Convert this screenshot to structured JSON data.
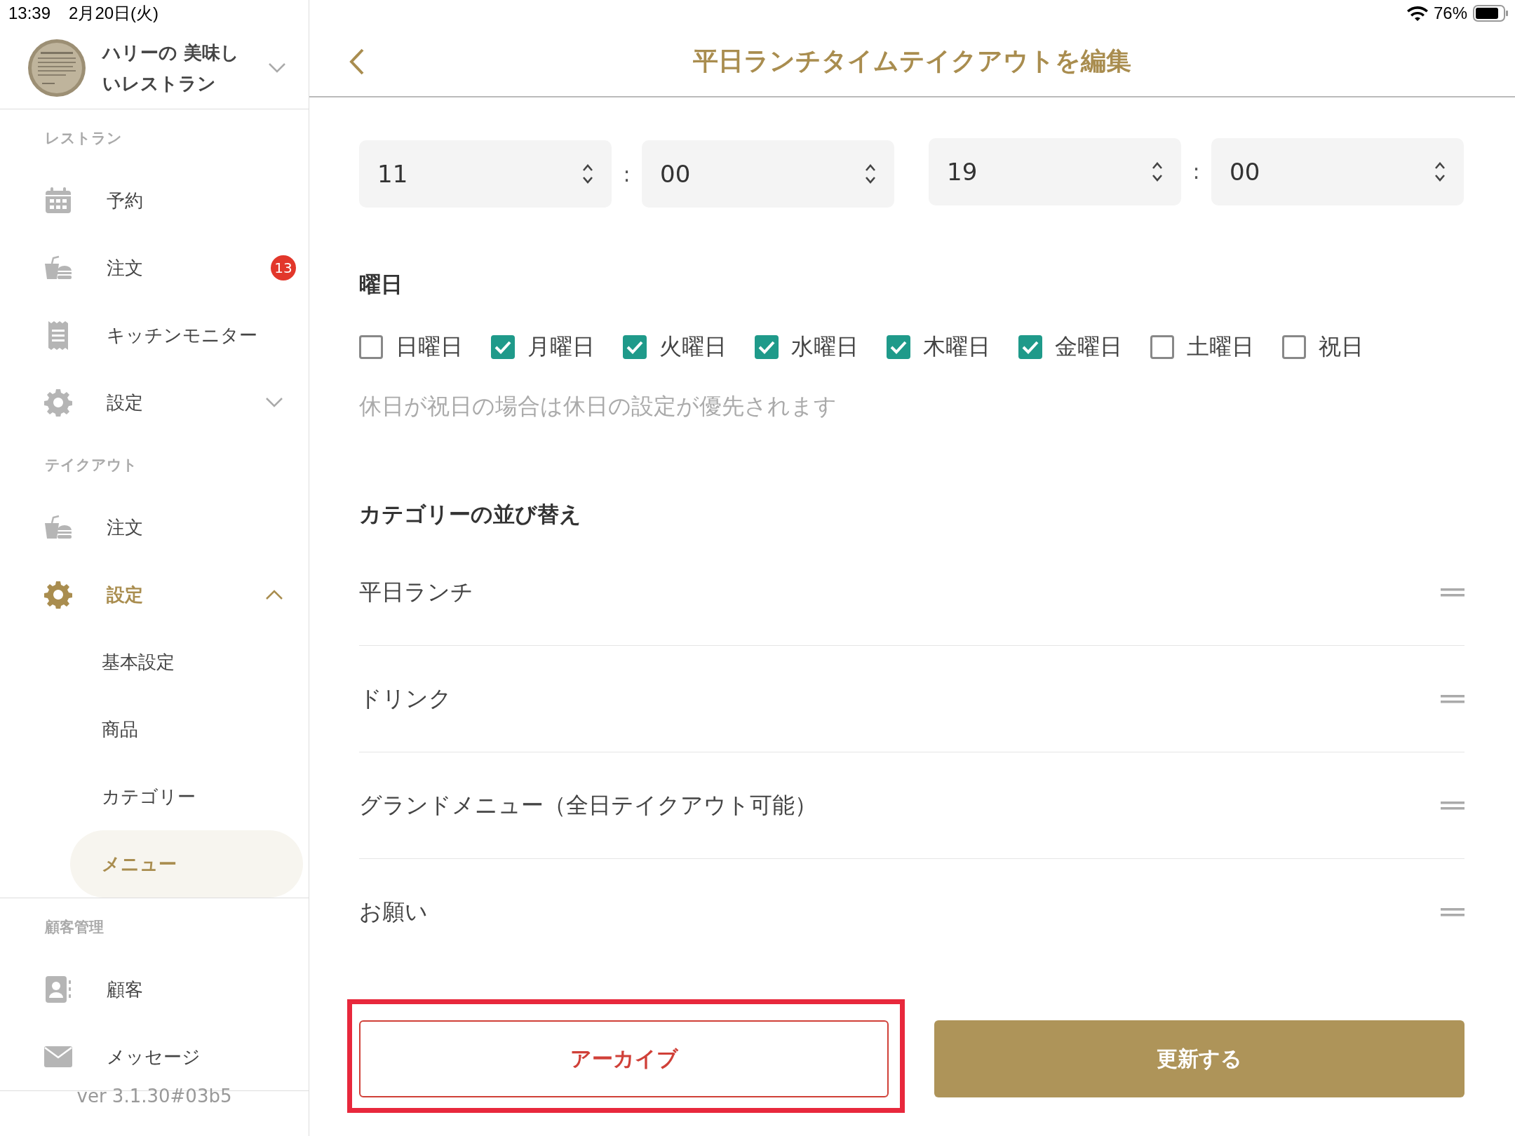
{
  "status_bar": {
    "time": "13:39",
    "date": "2月20日(火)",
    "battery": "76%"
  },
  "sidebar": {
    "account": {
      "name": "ハリーの 美味しいレストラン",
      "expanded": false
    },
    "sections": [
      {
        "title": "レストラン",
        "items": [
          {
            "label": "予約",
            "selected": false
          },
          {
            "label": "注文",
            "badge": "13",
            "selected": false
          },
          {
            "label": "キッチンモニター",
            "selected": false
          },
          {
            "label": "設定",
            "expanded": false,
            "selected": false
          }
        ]
      },
      {
        "title": "テイクアウト",
        "items": [
          {
            "label": "注文",
            "selected": false
          },
          {
            "label": "設定",
            "expanded": true,
            "selected": false,
            "children": [
              {
                "label": "基本設定",
                "selected": false
              },
              {
                "label": "商品",
                "selected": false
              },
              {
                "label": "カテゴリー",
                "selected": false
              },
              {
                "label": "メニュー",
                "selected": true
              }
            ]
          }
        ]
      },
      {
        "title": "顧客管理",
        "items": [
          {
            "label": "顧客",
            "selected": false
          },
          {
            "label": "メッセージ",
            "selected": false
          }
        ]
      }
    ],
    "version": "ver 3.1.30#03b5"
  },
  "header": {
    "title": "平日ランチタイムテイクアウトを編集"
  },
  "time_range": {
    "start": {
      "hour": "11",
      "separator": ":",
      "minute": "00"
    },
    "end": {
      "hour": "19",
      "separator": ":",
      "minute": "00"
    }
  },
  "weekdays": {
    "heading": "曜日",
    "days": [
      {
        "label": "日曜日",
        "checked": false
      },
      {
        "label": "月曜日",
        "checked": true
      },
      {
        "label": "火曜日",
        "checked": true
      },
      {
        "label": "水曜日",
        "checked": true
      },
      {
        "label": "木曜日",
        "checked": true
      },
      {
        "label": "金曜日",
        "checked": true
      },
      {
        "label": "土曜日",
        "checked": false
      },
      {
        "label": "祝日",
        "checked": false
      }
    ],
    "note": "休日が祝日の場合は休日の設定が優先されます"
  },
  "category_order": {
    "heading": "カテゴリーの並び替え",
    "items": [
      "平日ランチ",
      "ドリンク",
      "グランドメニュー（全日テイクアウト可能）",
      "お願い"
    ]
  },
  "buttons": {
    "archive": {
      "label": "アーカイブ",
      "highlighted": true
    },
    "update": {
      "label": "更新する"
    }
  }
}
